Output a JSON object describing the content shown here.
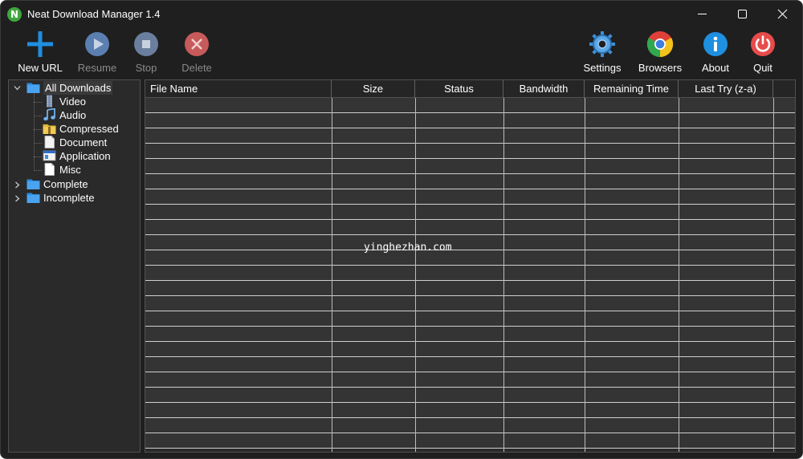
{
  "window": {
    "title": "Neat Download Manager 1.4",
    "app_icon_letter": "N"
  },
  "toolbar": {
    "new_url": "New URL",
    "resume": "Resume",
    "stop": "Stop",
    "delete": "Delete",
    "settings": "Settings",
    "browsers": "Browsers",
    "about": "About",
    "quit": "Quit"
  },
  "sidebar": {
    "all_downloads": "All Downloads",
    "video": "Video",
    "audio": "Audio",
    "compressed": "Compressed",
    "document": "Document",
    "application": "Application",
    "misc": "Misc",
    "complete": "Complete",
    "incomplete": "Incomplete"
  },
  "table": {
    "columns": [
      "File Name",
      "Size",
      "Status",
      "Bandwidth",
      "Remaining Time",
      "Last Try (z-a)"
    ],
    "rows": []
  },
  "watermark": "yinghezhan.com",
  "colors": {
    "background": "#1f1f1f",
    "panel": "#2a2a2a",
    "row": "#343434",
    "accent_blue": "#1f8fe0",
    "quit_red": "#e84b4b"
  }
}
